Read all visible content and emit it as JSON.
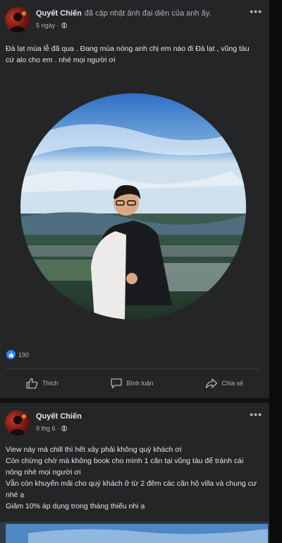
{
  "post1": {
    "author": "Quyết Chiến",
    "action_text": "đã cập nhật ảnh đại diện của anh ấy.",
    "time": "5 ngày ·",
    "more": "•••",
    "text": "Đà lạt mùa lễ đã qua . Đang mùa nóng anh chị em nào đi Đà lạt , vũng tàu cứ alo cho em . nhé mọi người ơi",
    "reaction_count": "190",
    "actions": {
      "like": "Thích",
      "comment": "Bình luận",
      "share": "Chia sẻ"
    }
  },
  "post2": {
    "author": "Quyết Chiến",
    "time": "9 thg 6 ·",
    "more": "•••",
    "lines": [
      "View này mà chill thì hết xảy phải không quý khách ơi",
      "Còn chừng chờ mà không book cho mình 1 căn tại  vũng tàu để tránh cái nóng nhé mọi người ơi",
      "Vẫn còn khuyến mãi cho quý khách ở từ 2 đêm các căn hộ villa và chung cư nhé ạ",
      "Giảm 10% áp dụng trong tháng thiếu nhi ạ"
    ]
  },
  "colors": {
    "background": "#111214",
    "card": "#242526",
    "text": "#e4e6eb",
    "secondary_text": "#b0b3b8",
    "like_blue": "#2d88ff"
  },
  "icons": [
    "more-icon",
    "globe-icon",
    "like-icon",
    "comment-icon",
    "share-icon"
  ]
}
